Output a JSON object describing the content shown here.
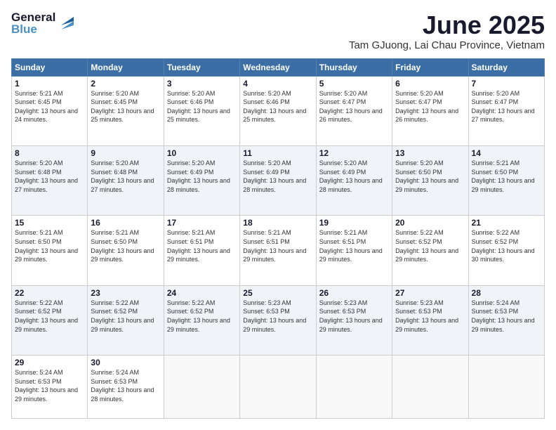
{
  "header": {
    "logo_line1": "General",
    "logo_line2": "Blue",
    "title": "June 2025",
    "subtitle": "Tam GJuong, Lai Chau Province, Vietnam"
  },
  "weekdays": [
    "Sunday",
    "Monday",
    "Tuesday",
    "Wednesday",
    "Thursday",
    "Friday",
    "Saturday"
  ],
  "weeks": [
    [
      {
        "day": "1",
        "sunrise": "5:21 AM",
        "sunset": "6:45 PM",
        "daylight": "13 hours and 24 minutes."
      },
      {
        "day": "2",
        "sunrise": "5:20 AM",
        "sunset": "6:45 PM",
        "daylight": "13 hours and 25 minutes."
      },
      {
        "day": "3",
        "sunrise": "5:20 AM",
        "sunset": "6:46 PM",
        "daylight": "13 hours and 25 minutes."
      },
      {
        "day": "4",
        "sunrise": "5:20 AM",
        "sunset": "6:46 PM",
        "daylight": "13 hours and 25 minutes."
      },
      {
        "day": "5",
        "sunrise": "5:20 AM",
        "sunset": "6:47 PM",
        "daylight": "13 hours and 26 minutes."
      },
      {
        "day": "6",
        "sunrise": "5:20 AM",
        "sunset": "6:47 PM",
        "daylight": "13 hours and 26 minutes."
      },
      {
        "day": "7",
        "sunrise": "5:20 AM",
        "sunset": "6:47 PM",
        "daylight": "13 hours and 27 minutes."
      }
    ],
    [
      {
        "day": "8",
        "sunrise": "5:20 AM",
        "sunset": "6:48 PM",
        "daylight": "13 hours and 27 minutes."
      },
      {
        "day": "9",
        "sunrise": "5:20 AM",
        "sunset": "6:48 PM",
        "daylight": "13 hours and 27 minutes."
      },
      {
        "day": "10",
        "sunrise": "5:20 AM",
        "sunset": "6:49 PM",
        "daylight": "13 hours and 28 minutes."
      },
      {
        "day": "11",
        "sunrise": "5:20 AM",
        "sunset": "6:49 PM",
        "daylight": "13 hours and 28 minutes."
      },
      {
        "day": "12",
        "sunrise": "5:20 AM",
        "sunset": "6:49 PM",
        "daylight": "13 hours and 28 minutes."
      },
      {
        "day": "13",
        "sunrise": "5:20 AM",
        "sunset": "6:50 PM",
        "daylight": "13 hours and 29 minutes."
      },
      {
        "day": "14",
        "sunrise": "5:21 AM",
        "sunset": "6:50 PM",
        "daylight": "13 hours and 29 minutes."
      }
    ],
    [
      {
        "day": "15",
        "sunrise": "5:21 AM",
        "sunset": "6:50 PM",
        "daylight": "13 hours and 29 minutes."
      },
      {
        "day": "16",
        "sunrise": "5:21 AM",
        "sunset": "6:50 PM",
        "daylight": "13 hours and 29 minutes."
      },
      {
        "day": "17",
        "sunrise": "5:21 AM",
        "sunset": "6:51 PM",
        "daylight": "13 hours and 29 minutes."
      },
      {
        "day": "18",
        "sunrise": "5:21 AM",
        "sunset": "6:51 PM",
        "daylight": "13 hours and 29 minutes."
      },
      {
        "day": "19",
        "sunrise": "5:21 AM",
        "sunset": "6:51 PM",
        "daylight": "13 hours and 29 minutes."
      },
      {
        "day": "20",
        "sunrise": "5:22 AM",
        "sunset": "6:52 PM",
        "daylight": "13 hours and 29 minutes."
      },
      {
        "day": "21",
        "sunrise": "5:22 AM",
        "sunset": "6:52 PM",
        "daylight": "13 hours and 30 minutes."
      }
    ],
    [
      {
        "day": "22",
        "sunrise": "5:22 AM",
        "sunset": "6:52 PM",
        "daylight": "13 hours and 29 minutes."
      },
      {
        "day": "23",
        "sunrise": "5:22 AM",
        "sunset": "6:52 PM",
        "daylight": "13 hours and 29 minutes."
      },
      {
        "day": "24",
        "sunrise": "5:22 AM",
        "sunset": "6:52 PM",
        "daylight": "13 hours and 29 minutes."
      },
      {
        "day": "25",
        "sunrise": "5:23 AM",
        "sunset": "6:53 PM",
        "daylight": "13 hours and 29 minutes."
      },
      {
        "day": "26",
        "sunrise": "5:23 AM",
        "sunset": "6:53 PM",
        "daylight": "13 hours and 29 minutes."
      },
      {
        "day": "27",
        "sunrise": "5:23 AM",
        "sunset": "6:53 PM",
        "daylight": "13 hours and 29 minutes."
      },
      {
        "day": "28",
        "sunrise": "5:24 AM",
        "sunset": "6:53 PM",
        "daylight": "13 hours and 29 minutes."
      }
    ],
    [
      {
        "day": "29",
        "sunrise": "5:24 AM",
        "sunset": "6:53 PM",
        "daylight": "13 hours and 29 minutes."
      },
      {
        "day": "30",
        "sunrise": "5:24 AM",
        "sunset": "6:53 PM",
        "daylight": "13 hours and 28 minutes."
      },
      null,
      null,
      null,
      null,
      null
    ]
  ]
}
